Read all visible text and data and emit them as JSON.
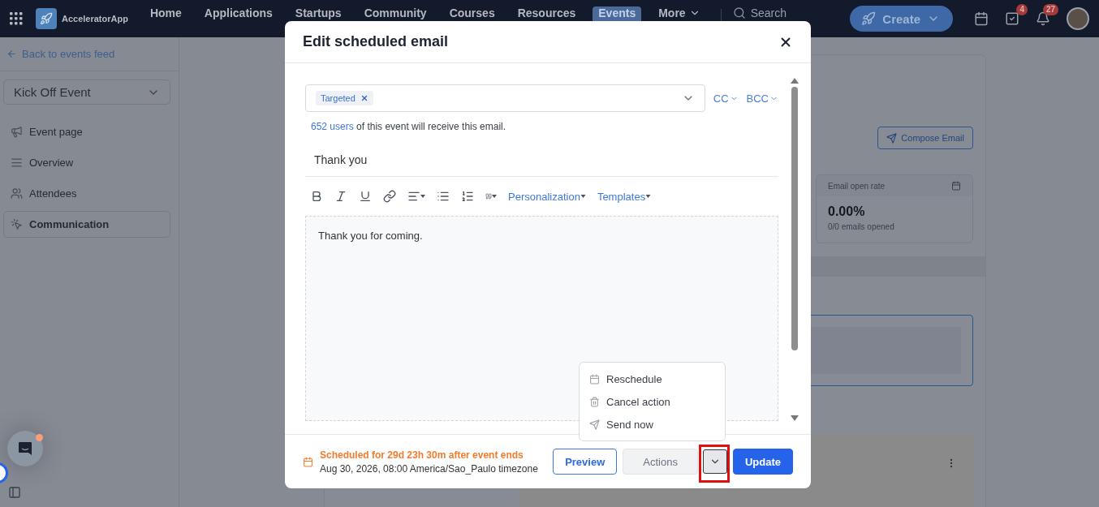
{
  "top_nav": {
    "brand": "AcceleratorApp",
    "links": [
      {
        "label": "Home",
        "selected": false
      },
      {
        "label": "Applications",
        "selected": false
      },
      {
        "label": "Startups",
        "selected": false
      },
      {
        "label": "Community",
        "selected": false
      },
      {
        "label": "Courses",
        "selected": false
      },
      {
        "label": "Resources",
        "selected": false
      },
      {
        "label": "Events",
        "selected": true
      }
    ],
    "more": "More",
    "search": {
      "placeholder": "Search"
    },
    "create_button": "Create",
    "tasks_badge": "4",
    "notifications_badge": "27"
  },
  "sidebar": {
    "back_link": "Back to events feed",
    "event_select": "Kick Off Event",
    "items": [
      {
        "label": "Event page",
        "kind": "megaphone",
        "selected": false
      },
      {
        "label": "Overview",
        "kind": "lines",
        "selected": false
      },
      {
        "label": "Attendees",
        "kind": "people",
        "selected": false
      },
      {
        "label": "Communication",
        "kind": "pointer",
        "selected": true
      }
    ]
  },
  "main": {
    "compose_button": "Compose Email",
    "stat_card": {
      "title": "Email open rate",
      "value": "0.00%",
      "caption": "0/0 emails opened"
    }
  },
  "modal": {
    "title": "Edit scheduled email",
    "recipients": {
      "tags": [
        "Targeted"
      ]
    },
    "cc": "CC",
    "bcc": "BCC",
    "audience": {
      "count": "652 users",
      "text": "of this event will receive this email."
    },
    "subject": "Thank you",
    "toolbar": {
      "personalization": "Personalization",
      "templates": "Templates"
    },
    "body": "Thank you for coming.",
    "schedule": {
      "relative": "Scheduled for 29d 23h 30m after event ends",
      "absolute": "Aug 30, 2026, 08:00 America/Sao_Paulo timezone"
    },
    "buttons": {
      "preview": "Preview",
      "actions": "Actions",
      "update": "Update"
    },
    "actions_menu": [
      {
        "label": "Reschedule",
        "kind": "calendar"
      },
      {
        "label": "Cancel action",
        "kind": "trash"
      },
      {
        "label": "Send now",
        "kind": "send"
      }
    ]
  }
}
